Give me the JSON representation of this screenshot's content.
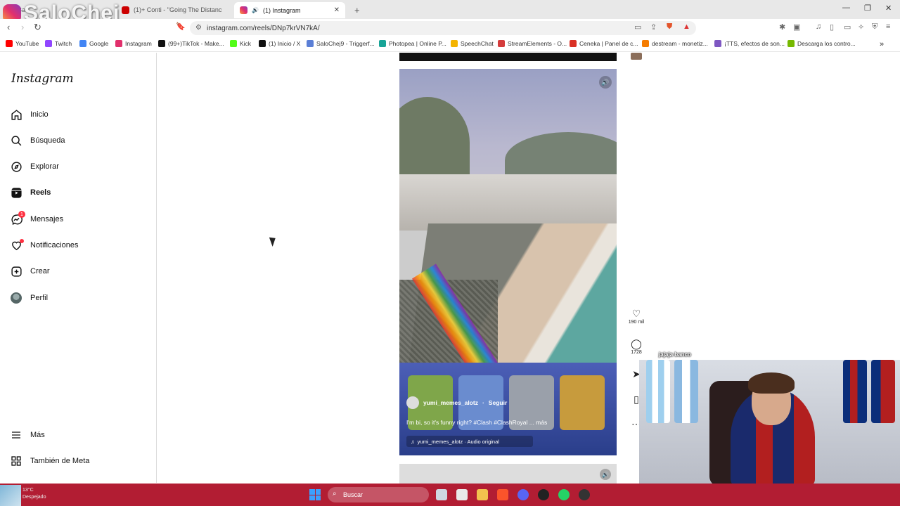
{
  "watermark": "SaloChej",
  "tabs": [
    {
      "label": "Ba...",
      "active": false
    },
    {
      "label": "(1)+ Conti - \"Going The Distanc",
      "active": false
    },
    {
      "label": "(1) Instagram",
      "active": true
    }
  ],
  "new_tab_glyph": "+",
  "address": {
    "url": "instagram.com/reels/DNp7krVN7kA/"
  },
  "bookmarks": [
    {
      "label": "YouTube",
      "color": "#ff0000"
    },
    {
      "label": "Twitch",
      "color": "#9146ff"
    },
    {
      "label": "Google",
      "color": "#4285f4"
    },
    {
      "label": "Instagram",
      "color": "#e1306c"
    },
    {
      "label": "(99+)TikTok - Make...",
      "color": "#111111"
    },
    {
      "label": "Kick",
      "color": "#53fc18"
    },
    {
      "label": "(1) Inicio / X",
      "color": "#111111"
    },
    {
      "label": "SaloChej9 - Triggerf...",
      "color": "#5b7fd6"
    },
    {
      "label": "Photopea | Online P...",
      "color": "#18a497"
    },
    {
      "label": "SpeechChat",
      "color": "#f4b400"
    },
    {
      "label": "StreamElements - O...",
      "color": "#d43c3c"
    },
    {
      "label": "Ceneka | Panel de c...",
      "color": "#d93025"
    },
    {
      "label": "destream - monetiz...",
      "color": "#f57c00"
    },
    {
      "label": "¡TTS, efectos de son...",
      "color": "#7e57c2"
    },
    {
      "label": "Descarga los contro...",
      "color": "#76b900"
    }
  ],
  "sidebar": {
    "logo": "Instagram",
    "items": [
      {
        "label": "Inicio",
        "icon": "home-icon"
      },
      {
        "label": "Búsqueda",
        "icon": "search-icon"
      },
      {
        "label": "Explorar",
        "icon": "compass-icon"
      },
      {
        "label": "Reels",
        "icon": "reels-icon"
      },
      {
        "label": "Mensajes",
        "icon": "messenger-icon",
        "badge": "1"
      },
      {
        "label": "Notificaciones",
        "icon": "heart-icon"
      },
      {
        "label": "Crear",
        "icon": "plus-square-icon"
      },
      {
        "label": "Perfil",
        "icon": "avatar"
      }
    ],
    "more": "Más",
    "meta": "También de Meta"
  },
  "reel": {
    "username": "yumi_memes_alotz",
    "follow": "Seguir",
    "caption": "I'm bi, so it's funny right? #Clash #ClashRoyal ... más",
    "audio": "yumi_memes_alotz · Audio original",
    "likes": "190 mil",
    "comments": "1728"
  },
  "chat_overlay": "jajaja banco",
  "taskbar": {
    "weather_temp": "13°C",
    "weather_desc": "Despejado",
    "search_placeholder": "Buscar"
  }
}
